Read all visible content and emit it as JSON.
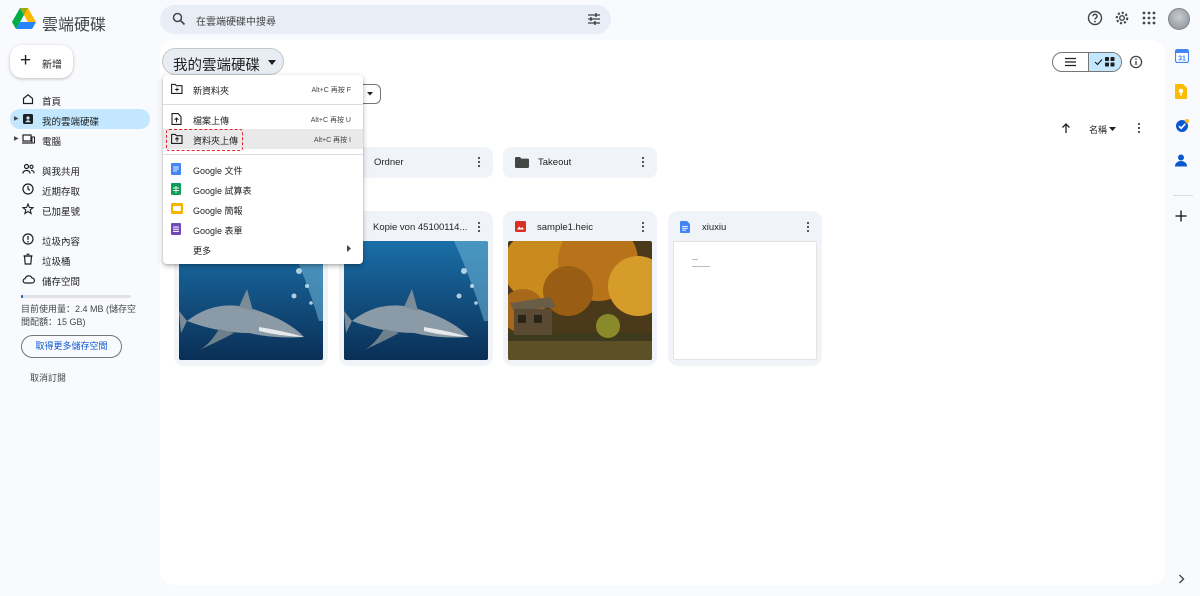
{
  "app": {
    "title": "雲端硬碟"
  },
  "search": {
    "placeholder": "在雲端硬碟中搜尋"
  },
  "left_nav": {
    "new_label": "新增",
    "items": [
      {
        "label": "首頁"
      },
      {
        "label": "我的雲端硬碟"
      },
      {
        "label": "電腦"
      },
      {
        "label": "與我共用"
      },
      {
        "label": "近期存取"
      },
      {
        "label": "已加星號"
      },
      {
        "label": "垃圾內容"
      },
      {
        "label": "垃圾桶"
      },
      {
        "label": "儲存空間"
      }
    ],
    "storage_text": "目前使用量：2.4 MB (儲存空間配額：15 GB)",
    "get_storage_label": "取得更多儲存空間",
    "unsubscribe_label": "取消訂閱",
    "storage_used_fraction": 0.0002
  },
  "main": {
    "title": "我的雲端硬碟",
    "sort_label": "名稱"
  },
  "menu": {
    "items": [
      {
        "label": "新資料夾",
        "shortcut": "Alt+C 再按 F"
      },
      {
        "label": "檔案上傳",
        "shortcut": "Alt+C 再按 U"
      },
      {
        "label": "資料夾上傳",
        "shortcut": "Alt+C 再按 I"
      },
      {
        "label": "Google 文件"
      },
      {
        "label": "Google 試算表"
      },
      {
        "label": "Google 簡報"
      },
      {
        "label": "Google 表單"
      },
      {
        "label": "更多"
      }
    ]
  },
  "folders": [
    {
      "name": "Ordner"
    },
    {
      "name": "Takeout"
    }
  ],
  "files": [
    {
      "name": "",
      "type": "image"
    },
    {
      "name": "Kopie von 45100114...",
      "type": "image"
    },
    {
      "name": "sample1.heic",
      "type": "image"
    },
    {
      "name": "xiuxiu",
      "type": "doc"
    }
  ],
  "colors": {
    "accent": "#0b57d0",
    "active_nav": "#c2e7ff",
    "highlight_box": "#e0262c",
    "docs_blue": "#4285f4",
    "sheets_green": "#0f9d58",
    "slides_yellow": "#f4b400",
    "forms_purple": "#7248b9",
    "image_red": "#d93025"
  }
}
